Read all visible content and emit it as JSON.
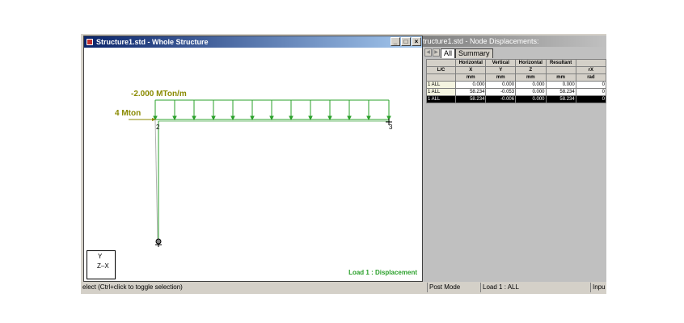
{
  "left_window": {
    "title": "Structure1.std - Whole Structure",
    "buttons": {
      "minimize": "_",
      "maximize": "□",
      "close": "×"
    },
    "labels": {
      "udl": "-2.000 MTon/m",
      "point_load": "4 Mton",
      "node2": "2",
      "node3": "3",
      "status": "Load 1 : Displacement"
    },
    "axis": {
      "y": "Y",
      "zx": "Z–X"
    },
    "colors": {
      "member": "#2aa02a",
      "load": "#8a8a00"
    }
  },
  "right_window": {
    "title": "tructure1.std - Node Displacements:",
    "tabs": [
      "All",
      "Summary"
    ],
    "table": {
      "header_row1": [
        "",
        "Horizontal",
        "Vertical",
        "Horizontal",
        "Resultant",
        ""
      ],
      "header_row2": [
        "L/C",
        "X",
        "Y",
        "Z",
        "",
        "rX"
      ],
      "header_row3": [
        "",
        "mm",
        "mm",
        "mm",
        "mm",
        "rad"
      ],
      "rows": [
        [
          "1 ALL",
          "0.000",
          "0.000",
          "0.000",
          "0.000",
          "0"
        ],
        [
          "1 ALL",
          "58.234",
          "-0.053",
          "0.000",
          "58.234",
          "0"
        ],
        [
          "1 ALL",
          "58.234",
          "-0.006",
          "0.000",
          "58.234",
          "0"
        ]
      ]
    }
  },
  "statusbar": {
    "hint": "elect (Ctrl+click to toggle selection)",
    "mode": "Post Mode",
    "load": "Load 1 : ALL",
    "input": "Inpu"
  }
}
